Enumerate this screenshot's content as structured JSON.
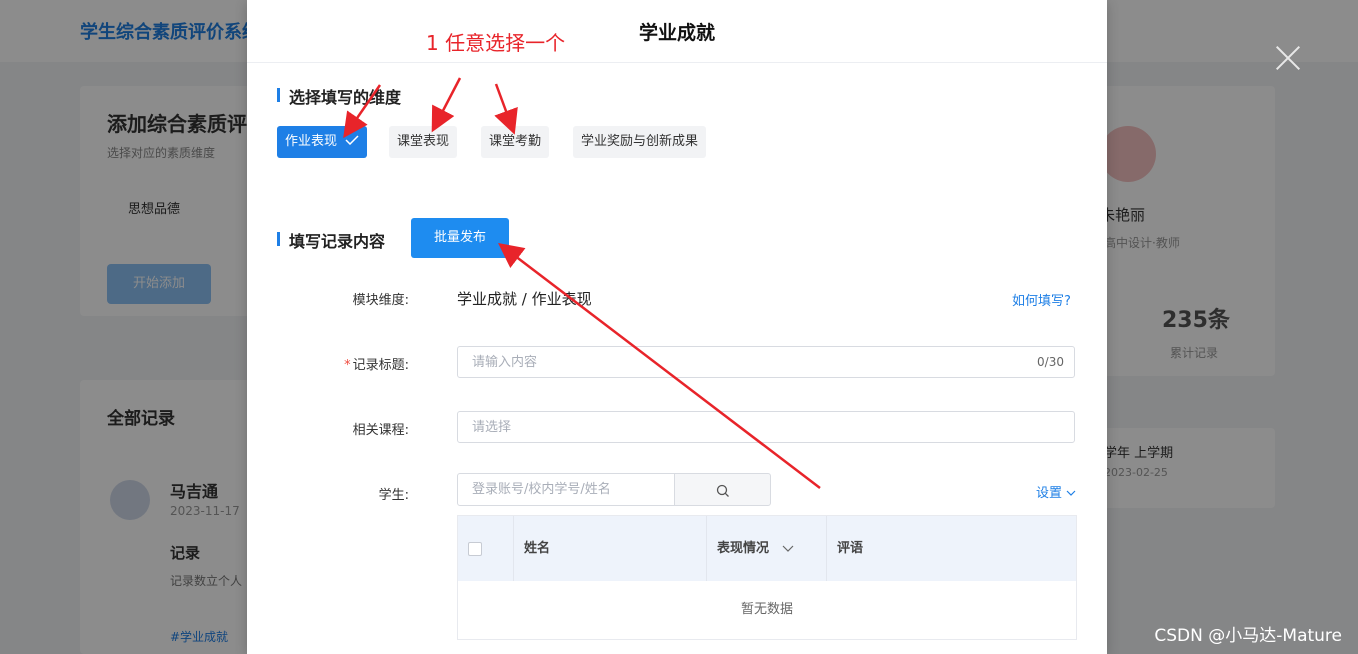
{
  "background": {
    "app_title": "学生综合素质评价系统",
    "card_title": "添加综合素质评价",
    "card_sub": "选择对应的素质维度",
    "tab_text": "思想品德",
    "add_button": "开始添加",
    "records_title": "全部记录",
    "record_name": "马吉通",
    "record_date": "2023-11-17",
    "record_heading": "记录",
    "record_body": "记录数立个人",
    "record_tag": "#学业成就",
    "profile_name": "朱艳丽",
    "profile_sub": "高中设计·教师",
    "count": "235条",
    "count_label": "累计记录",
    "term": "学年 上学期",
    "term_date": "2023-02-25"
  },
  "dialog": {
    "title": "学业成就",
    "dimension_section": "选择填写的维度",
    "dimensions": [
      {
        "label": "作业表现",
        "active": true
      },
      {
        "label": "课堂表现",
        "active": false
      },
      {
        "label": "课堂考勤",
        "active": false
      },
      {
        "label": "学业奖励与创新成果",
        "active": false
      }
    ],
    "content_section": "填写记录内容",
    "batch_button": "批量发布",
    "form": {
      "module_label": "模块维度:",
      "module_value": "学业成就 / 作业表现",
      "help_link": "如何填写?",
      "title_label": "记录标题:",
      "title_placeholder": "请输入内容",
      "title_counter": "0/30",
      "course_label": "相关课程:",
      "course_placeholder": "请选择",
      "student_label": "学生:",
      "student_placeholder": "登录账号/校内学号/姓名",
      "settings_link": "设置"
    },
    "table": {
      "headers": [
        "姓名",
        "表现情况",
        "评语"
      ],
      "empty": "暂无数据"
    }
  },
  "annotation": {
    "text": "1 任意选择一个",
    "color": "#e8242a"
  },
  "watermark": "CSDN @小马达-Mature"
}
